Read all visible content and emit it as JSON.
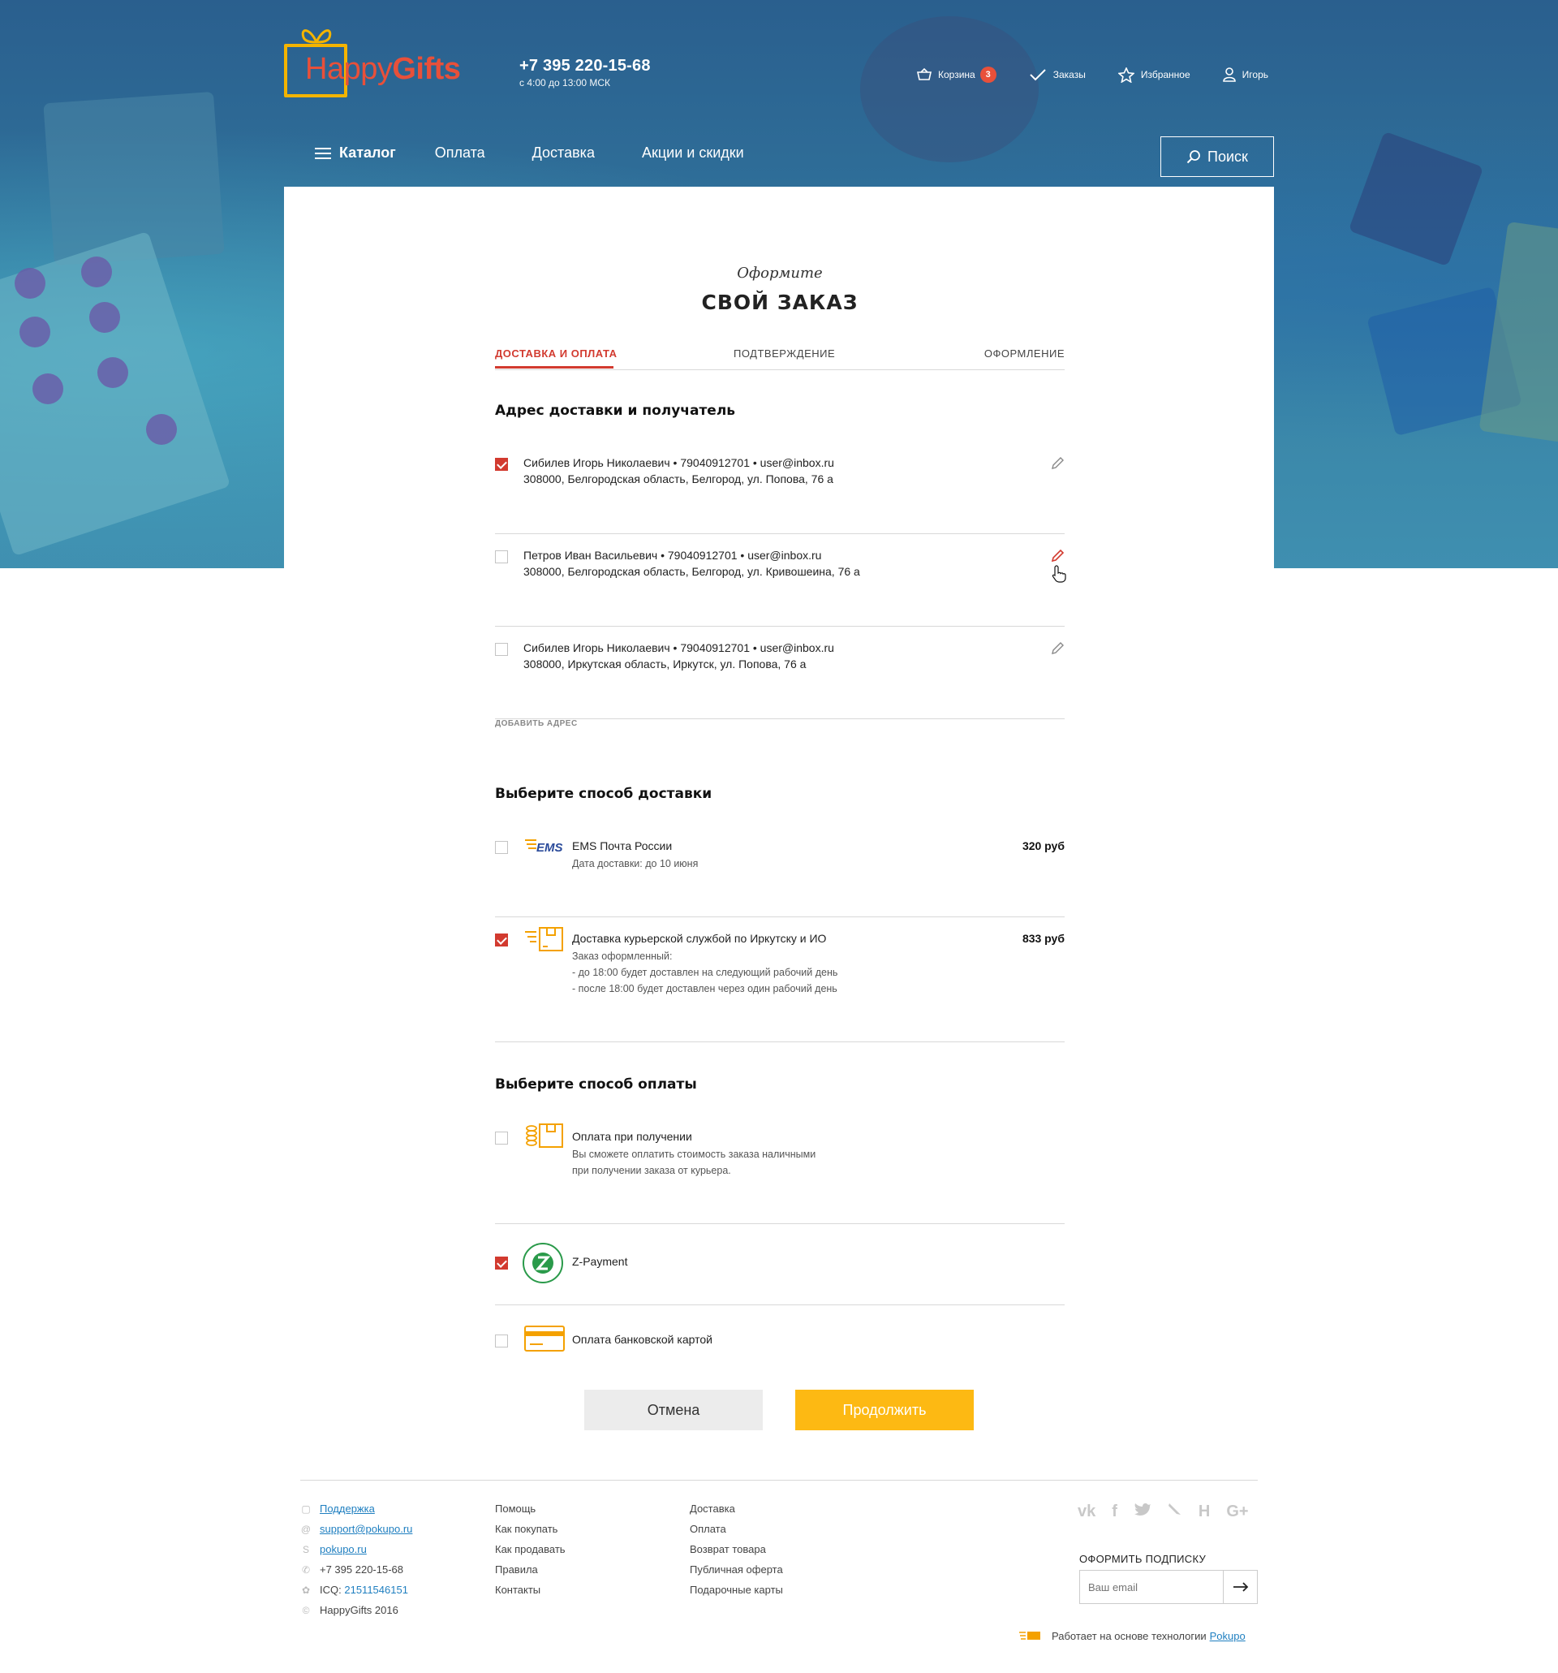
{
  "brand": {
    "logo_part1": "Happy",
    "logo_part2": "Gifts",
    "accent": "#f4b400",
    "red": "#d23a2f"
  },
  "header": {
    "phone": "+7 395 220-15-68",
    "hours": "с 4:00 до 13:00 МСК",
    "cart_label": "Корзина",
    "cart_count": "3",
    "orders_label": "Заказы",
    "favorites_label": "Избранное",
    "user_label": "Игорь"
  },
  "nav": {
    "catalog": "Каталог",
    "items": [
      "Оплата",
      "Доставка",
      "Акции и скидки"
    ],
    "search_label": "Поиск"
  },
  "page": {
    "subtitle": "Оформите",
    "title": "СВОЙ ЗАКАЗ",
    "steps": [
      "ДОСТАВКА И ОПЛАТА",
      "ПОДТВЕРЖДЕНИЕ",
      "ОФОРМЛЕНИЕ"
    ]
  },
  "address_section": {
    "title": "Адрес доставки и получатель",
    "addresses": [
      {
        "line1": "Сибилев Игорь Николаевич • 79040912701 • user@inbox.ru",
        "line2": "308000, Белгородская область, Белгород, ул. Попова, 76 а",
        "checked": true
      },
      {
        "line1": "Петров Иван Васильевич • 79040912701 • user@inbox.ru",
        "line2": "308000, Белгородская область, Белгород, ул. Кривошеина, 76 а",
        "checked": false
      },
      {
        "line1": "Сибилев Игорь Николаевич • 79040912701 • user@inbox.ru",
        "line2": "308000, Иркутская область, Иркутск, ул. Попова, 76 а",
        "checked": false
      }
    ],
    "add_label": "ДОБАВИТЬ АДРЕС"
  },
  "delivery_section": {
    "title": "Выберите способ доставки",
    "options": [
      {
        "name": "EMS Почта России",
        "logo_text": "EMS",
        "details": [
          "Дата доставки: до 10 июня"
        ],
        "price": "320 руб",
        "checked": false
      },
      {
        "name": "Доставка курьерской службой по Иркутску и ИО",
        "details": [
          "Заказ оформленный:",
          "- до 18:00 будет доставлен на следующий рабочий день",
          "- после 18:00 будет доставлен через один рабочий день"
        ],
        "price": "833 руб",
        "checked": true
      }
    ]
  },
  "payment_section": {
    "title": "Выберите способ оплаты",
    "options": [
      {
        "name": "Оплата при получении",
        "details": [
          "Вы сможете оплатить стоимость заказа наличными",
          "при получении заказа от курьера."
        ],
        "checked": false
      },
      {
        "name": "Z-Payment",
        "checked": true
      },
      {
        "name": "Оплата банковской картой",
        "checked": false
      }
    ]
  },
  "actions": {
    "cancel": "Отмена",
    "continue": "Продолжить"
  },
  "footer": {
    "contacts": {
      "support": "Поддержка",
      "email": "support@pokupo.ru",
      "skype": "pokupo.ru",
      "phone": "+7 395 220-15-68",
      "icq_label": "ICQ:",
      "icq_value": "21511546151",
      "copyright": "HappyGifts 2016"
    },
    "col2": [
      "Помощь",
      "Как покупать",
      "Как продавать",
      "Правила",
      "Контакты"
    ],
    "col3": [
      "Доставка",
      "Оплата",
      "Возврат товара",
      "Публичная оферта",
      "Подарочные карты"
    ],
    "subscribe_title": "ОФОРМИТЬ ПОДПИСКУ",
    "subscribe_placeholder": "Ваш email",
    "powered_text": "Работает на основе технологии",
    "powered_link": "Pokupo"
  }
}
